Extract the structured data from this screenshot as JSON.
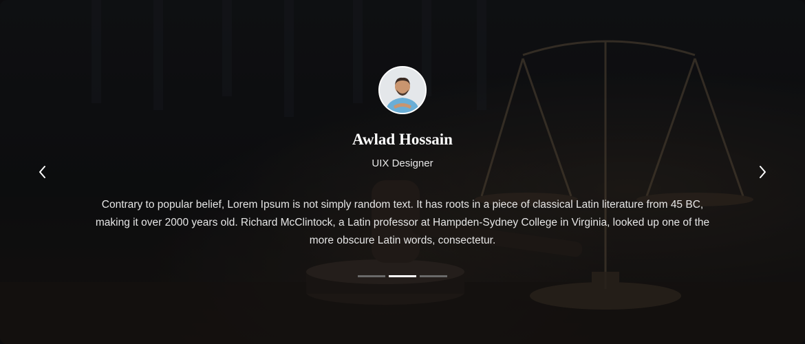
{
  "testimonial": {
    "name": "Awlad Hossain",
    "role": "UIX Designer",
    "quote": "Contrary to popular belief, Lorem Ipsum is not simply random text. It has roots in a piece of classical Latin literature from 45 BC, making it over 2000 years old. Richard McClintock, a Latin professor at Hampden-Sydney College in Virginia, looked up one of the more obscure Latin words, consectetur."
  },
  "carousel": {
    "slide_count": 3,
    "active_index": 1,
    "prev_icon": "chevron-left-icon",
    "next_icon": "chevron-right-icon"
  },
  "colors": {
    "text": "#ffffff",
    "dot_inactive": "#6a6a6a",
    "dot_active": "#ffffff"
  }
}
